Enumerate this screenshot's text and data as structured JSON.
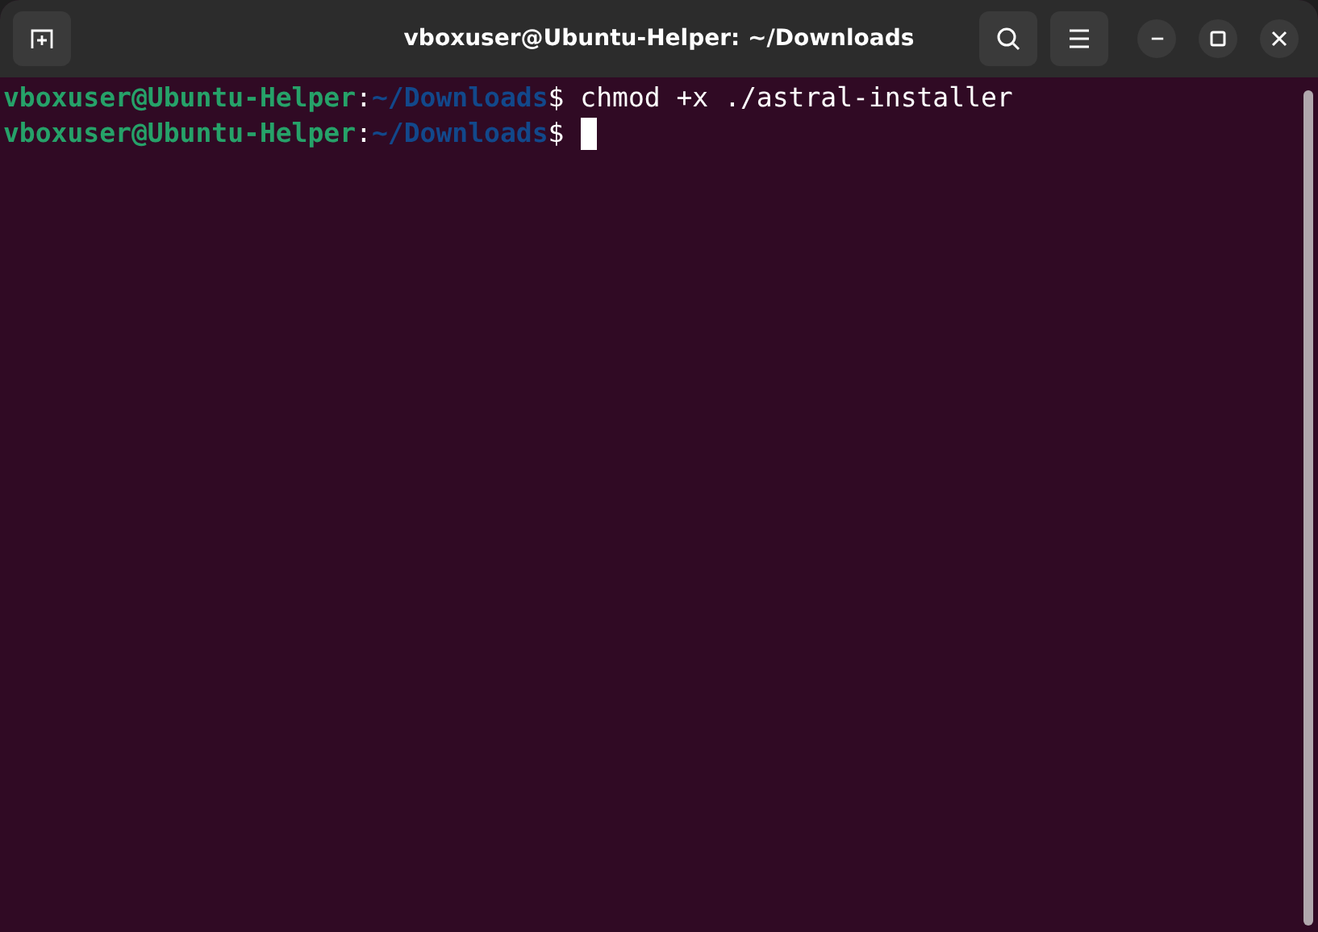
{
  "window": {
    "title": "vboxuser@Ubuntu-Helper: ~/Downloads"
  },
  "terminal": {
    "lines": [
      {
        "user_host": "vboxuser@Ubuntu-Helper",
        "separator": ":",
        "path": "~/Downloads",
        "prompt": "$",
        "command": "chmod +x ./astral-installer",
        "cursor": false
      },
      {
        "user_host": "vboxuser@Ubuntu-Helper",
        "separator": ":",
        "path": "~/Downloads",
        "prompt": "$",
        "cursor": true
      }
    ]
  }
}
